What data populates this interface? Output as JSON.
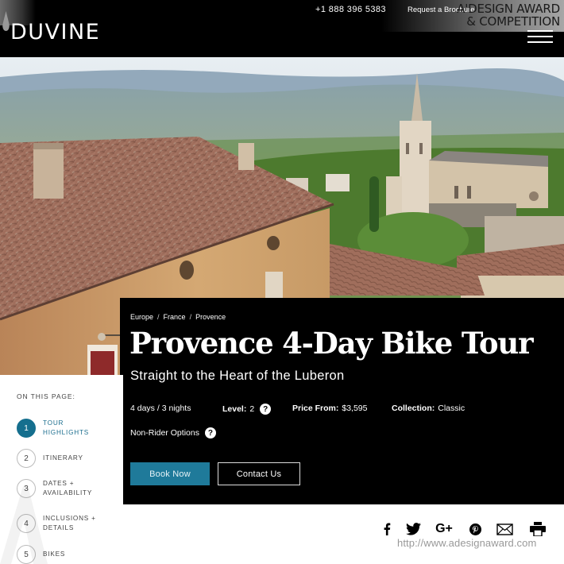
{
  "header": {
    "logo_text": "DUVINE",
    "phone": "+1 888 396 5383",
    "brochure_link": "Request a Brochure",
    "menu_icon": "hamburger-menu-icon"
  },
  "watermark": {
    "line1": "A'DESIGN AWARD",
    "line2": "& COMPETITION",
    "url": "http://www.adesignaward.com"
  },
  "hero": {
    "image_description": "Provence village rooftops with church steeple and Luberon valley"
  },
  "tour": {
    "breadcrumb": [
      "Europe",
      "France",
      "Provence"
    ],
    "title": "Provence 4-Day Bike Tour",
    "subtitle": "Straight to the Heart of the Luberon",
    "duration": "4 days / 3 nights",
    "level_label": "Level:",
    "level_value": "2",
    "price_label": "Price From:",
    "price_value": "$3,595",
    "collection_label": "Collection:",
    "collection_value": "Classic",
    "non_rider": "Non-Rider Options",
    "help_icon": "question-circle-icon",
    "book_button": "Book Now",
    "contact_button": "Contact Us"
  },
  "toc": {
    "heading": "ON THIS PAGE:",
    "items": [
      {
        "num": "1",
        "line1": "TOUR",
        "line2": "HIGHLIGHTS",
        "active": true
      },
      {
        "num": "2",
        "line1": "ITINERARY",
        "line2": "",
        "active": false
      },
      {
        "num": "3",
        "line1": "DATES +",
        "line2": "AVAILABILITY",
        "active": false
      },
      {
        "num": "4",
        "line1": "INCLUSIONS +",
        "line2": "DETAILS",
        "active": false
      },
      {
        "num": "5",
        "line1": "BIKES",
        "line2": "",
        "active": false
      }
    ]
  },
  "share": {
    "icons": [
      "facebook-icon",
      "twitter-icon",
      "google-plus-icon",
      "pinterest-icon",
      "email-icon",
      "print-icon"
    ],
    "google_plus_glyph": "G+"
  },
  "colors": {
    "accent": "#1f7a9a",
    "active_toc": "#156f8e",
    "header_bg": "#000000",
    "panel_bg": "#000000"
  }
}
